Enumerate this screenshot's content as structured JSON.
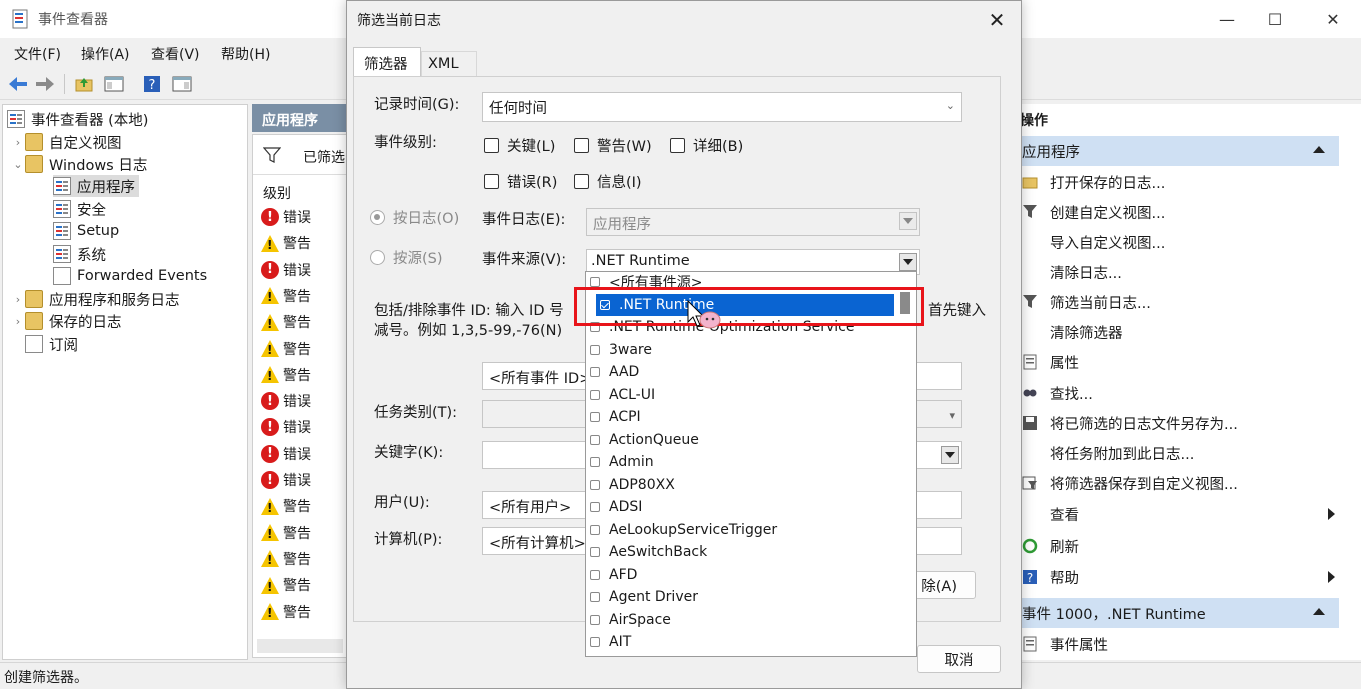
{
  "window": {
    "title": "事件查看器",
    "menu": [
      "文件(F)",
      "操作(A)",
      "查看(V)",
      "帮助(H)"
    ]
  },
  "tree": {
    "root": "事件查看器 (本地)",
    "items": [
      {
        "label": "自定义视图",
        "level": 1,
        "icon": "folder-icon"
      },
      {
        "label": "Windows 日志",
        "level": 1,
        "icon": "folder-icon"
      },
      {
        "label": "应用程序",
        "level": 2,
        "icon": "log-icon",
        "selected": true
      },
      {
        "label": "安全",
        "level": 2,
        "icon": "log-icon"
      },
      {
        "label": "Setup",
        "level": 2,
        "icon": "log-icon"
      },
      {
        "label": "系统",
        "level": 2,
        "icon": "log-icon"
      },
      {
        "label": "Forwarded Events",
        "level": 2,
        "icon": "log-icon"
      },
      {
        "label": "应用程序和服务日志",
        "level": 1,
        "icon": "folder-icon"
      },
      {
        "label": "保存的日志",
        "level": 1,
        "icon": "folder-icon"
      },
      {
        "label": "订阅",
        "level": 1,
        "icon": "doc-icon"
      }
    ]
  },
  "center": {
    "header": "应用程序",
    "filter_text": "已筛选",
    "column_level": "级别",
    "rows": [
      "错误",
      "警告",
      "错误",
      "警告",
      "警告",
      "警告",
      "警告",
      "错误",
      "错误",
      "错误",
      "错误",
      "警告",
      "警告",
      "警告",
      "警告",
      "警告"
    ]
  },
  "actions": {
    "header": "操作",
    "section1": "应用程序",
    "items": [
      {
        "label": "打开保存的日志...",
        "icon": "open-folder-icon"
      },
      {
        "label": "创建自定义视图...",
        "icon": "filter-icon"
      },
      {
        "label": "导入自定义视图...",
        "icon": ""
      },
      {
        "label": "清除日志...",
        "icon": ""
      },
      {
        "label": "筛选当前日志...",
        "icon": "filter-icon"
      },
      {
        "label": "清除筛选器",
        "icon": ""
      },
      {
        "label": "属性",
        "icon": "properties-icon"
      },
      {
        "label": "查找...",
        "icon": "find-icon"
      },
      {
        "label": "将已筛选的日志文件另存为...",
        "icon": "save-icon"
      },
      {
        "label": "将任务附加到此日志...",
        "icon": ""
      },
      {
        "label": "将筛选器保存到自定义视图...",
        "icon": "save-view-icon"
      },
      {
        "label": "查看",
        "icon": "",
        "submenu": true
      },
      {
        "label": "刷新",
        "icon": "refresh-icon"
      },
      {
        "label": "帮助",
        "icon": "help-icon",
        "submenu": true
      }
    ],
    "section2": "事件 1000，.NET Runtime",
    "section2_items": [
      {
        "label": "事件属性",
        "icon": "properties-icon"
      }
    ]
  },
  "status": "创建筛选器。",
  "dialog": {
    "title": "筛选当前日志",
    "tabs": [
      "筛选器",
      "XML"
    ],
    "logged_label": "记录时间(G):",
    "logged_value": "任何时间",
    "level_label": "事件级别:",
    "levels": [
      "关键(L)",
      "警告(W)",
      "详细(B)",
      "错误(R)",
      "信息(I)"
    ],
    "by_log": "按日志(O)",
    "by_source": "按源(S)",
    "event_log_label": "事件日志(E):",
    "event_log_value": "应用程序",
    "event_source_label": "事件来源(V):",
    "event_source_value": ".NET Runtime",
    "id_text_line1": "包括/排除事件 ID: 输入 ID 号",
    "id_text_line1_tail": "首先键入",
    "id_text_line2": "减号。例如 1,3,5-99,-76(N)",
    "id_field": "<所有事件 ID>",
    "task_label": "任务类别(T):",
    "keywords_label": "关键字(K):",
    "user_label": "用户(U):",
    "user_value": "<所有用户>",
    "computer_label": "计算机(P):",
    "computer_value": "<所有计算机>",
    "clear_button": "除(A)",
    "cancel_button": "取消"
  },
  "source_list": [
    {
      "label": "<所有事件源>",
      "checked": false
    },
    {
      "label": ".NET Runtime",
      "checked": true,
      "selected": true
    },
    {
      "label": ".NET Runtime Optimization Service",
      "checked": false
    },
    {
      "label": "3ware",
      "checked": false
    },
    {
      "label": "AAD",
      "checked": false
    },
    {
      "label": "ACL-UI",
      "checked": false
    },
    {
      "label": "ACPI",
      "checked": false
    },
    {
      "label": "ActionQueue",
      "checked": false
    },
    {
      "label": "Admin",
      "checked": false
    },
    {
      "label": "ADP80XX",
      "checked": false
    },
    {
      "label": "ADSI",
      "checked": false
    },
    {
      "label": "AeLookupServiceTrigger",
      "checked": false
    },
    {
      "label": "AeSwitchBack",
      "checked": false
    },
    {
      "label": "AFD",
      "checked": false
    },
    {
      "label": "Agent Driver",
      "checked": false
    },
    {
      "label": "AirSpace",
      "checked": false
    },
    {
      "label": "AIT",
      "checked": false
    }
  ],
  "colors": {
    "accent": "#0a64d2",
    "highlight": "#e8141a",
    "section_bg": "#cfe0f3",
    "pane_header": "#7a8fa5"
  }
}
